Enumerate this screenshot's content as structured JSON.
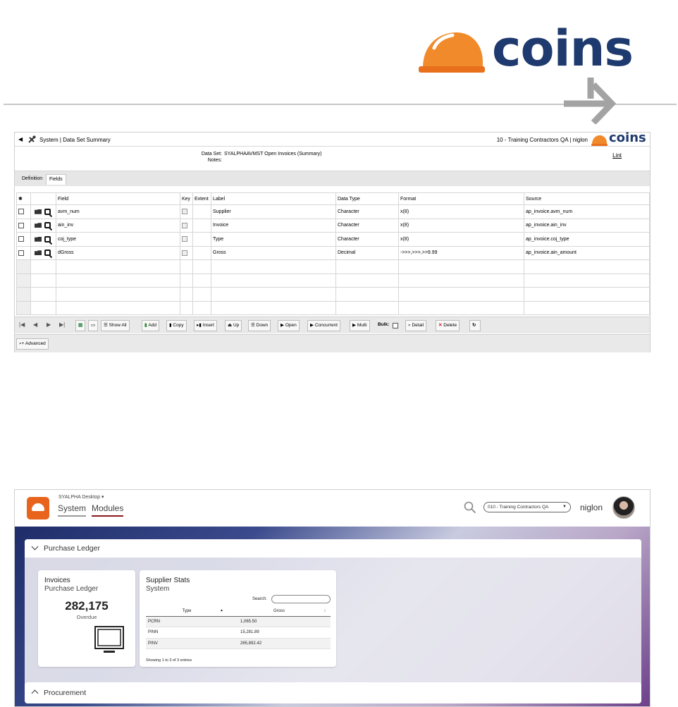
{
  "brand": {
    "wordmark": "coins",
    "accent": "#f08a2a",
    "navy": "#1f3a6e"
  },
  "dataset_screen": {
    "title": "System | Data Set Summary",
    "company_user": "10 - Training Contractors QA | niglon",
    "logo_text": "coins",
    "dataset_label": "Data Set:",
    "dataset_value": "SYALPHAAVMST   Open Invoices (Summary)",
    "notes_label": "Notes:",
    "lint_link": "Lint",
    "tabs": [
      "Definition",
      "Fields"
    ],
    "columns": [
      "Field",
      "Key",
      "Extent",
      "Label",
      "Data Type",
      "Format",
      "Source"
    ],
    "rows": [
      {
        "field": "avm_num",
        "label": "Supplier",
        "data_type": "Character",
        "format": "x(8)",
        "source": "ap_invoice.avm_num"
      },
      {
        "field": "ain_inv",
        "label": "Invoice",
        "data_type": "Character",
        "format": "x(8)",
        "source": "ap_invoice.ain_inv"
      },
      {
        "field": "coj_type",
        "label": "Type",
        "data_type": "Character",
        "format": "x(8)",
        "source": "ap_invoice.coj_type"
      },
      {
        "field": "dGross",
        "label": "Gross",
        "data_type": "Decimal",
        "format": "->>>,>>>,>>9.99",
        "source": "ap_invoice.ain_amount"
      }
    ],
    "toolbar": {
      "show_all": "Show All",
      "add": "Add",
      "copy": "Copy",
      "insert": "Insert",
      "up": "Up",
      "down": "Down",
      "open": "Open",
      "concurrent": "Concurrent",
      "multi": "Multi",
      "bulk": "Bulk:",
      "detail": "Detail",
      "delete": "Delete",
      "advanced": "Advanced"
    }
  },
  "desktop_screen": {
    "desktop_name": "SYALPHA Desktop ▾",
    "tabs": [
      "System",
      "Modules"
    ],
    "company": "010 - Training Contractors QA",
    "user": "niglon",
    "purchase_ledger": "Purchase Ledger",
    "procurement": "Procurement",
    "invoices_card": {
      "title": "Invoices",
      "subtitle": "Purchase Ledger",
      "value": "282,175",
      "caption": "Overdue"
    },
    "supplier_card": {
      "title": "Supplier Stats",
      "subtitle": "System",
      "search_label": "Search:",
      "columns": [
        "Type",
        "Gross"
      ],
      "rows": [
        {
          "type": "PCRN",
          "gross": "1,065.50"
        },
        {
          "type": "PINN",
          "gross": "15,281.89"
        },
        {
          "type": "PINV",
          "gross": "265,892.42"
        }
      ],
      "info": "Showing 1 to 3 of 3 entries"
    }
  }
}
